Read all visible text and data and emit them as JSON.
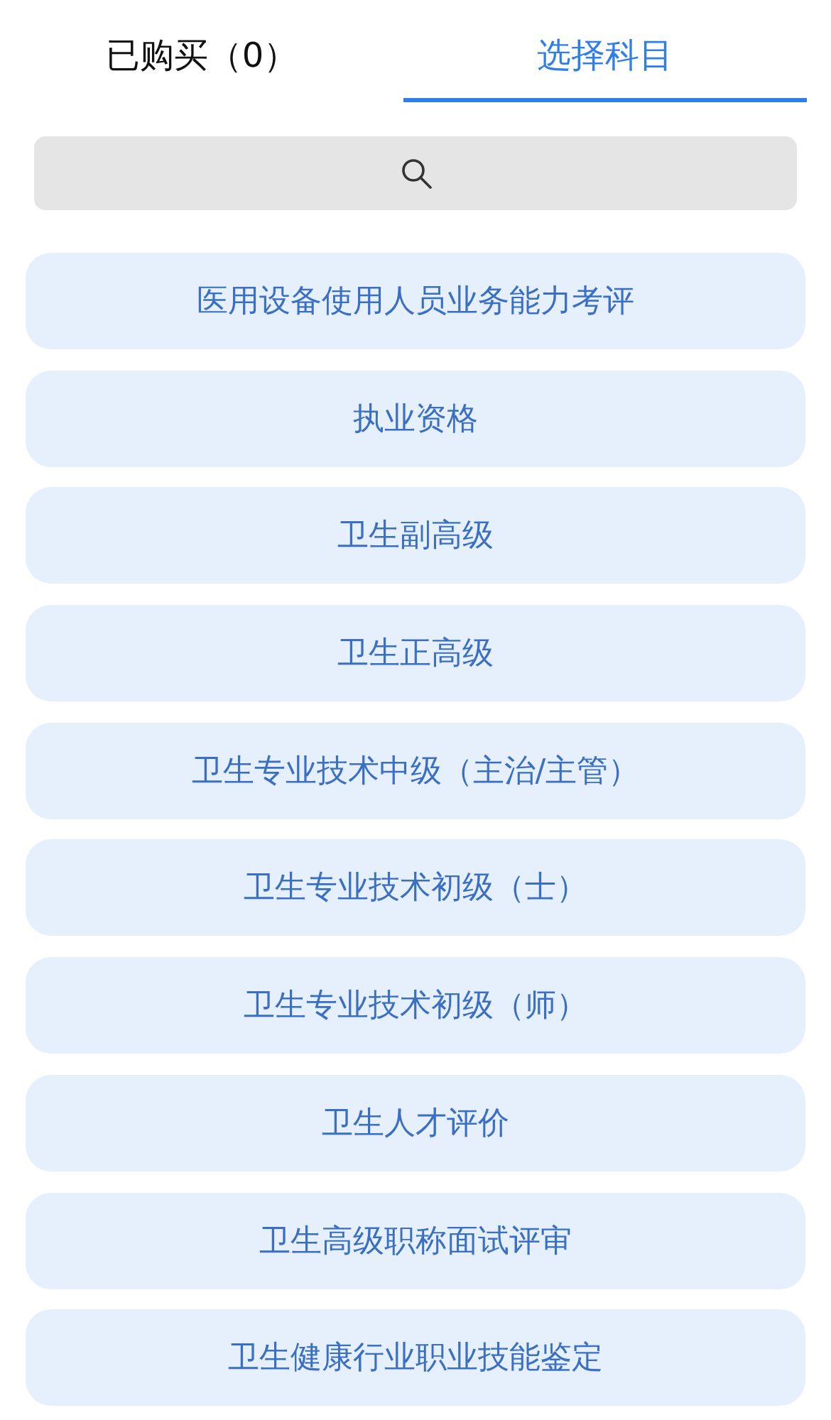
{
  "tabs": [
    {
      "label": "已购买（0）",
      "selected": false
    },
    {
      "label": "选择科目",
      "selected": true
    }
  ],
  "search": {
    "kind": "search"
  },
  "subjects": [
    {
      "label": "医用设备使用人员业务能力考评"
    },
    {
      "label": "执业资格"
    },
    {
      "label": "卫生副高级"
    },
    {
      "label": "卫生正高级"
    },
    {
      "label": "卫生专业技术中级（主治/主管）"
    },
    {
      "label": "卫生专业技术初级（士）"
    },
    {
      "label": "卫生专业技术初级（师）"
    },
    {
      "label": "卫生人才评价"
    },
    {
      "label": "卫生高级职称面试评审"
    },
    {
      "label": "卫生健康行业职业技能鉴定"
    }
  ]
}
